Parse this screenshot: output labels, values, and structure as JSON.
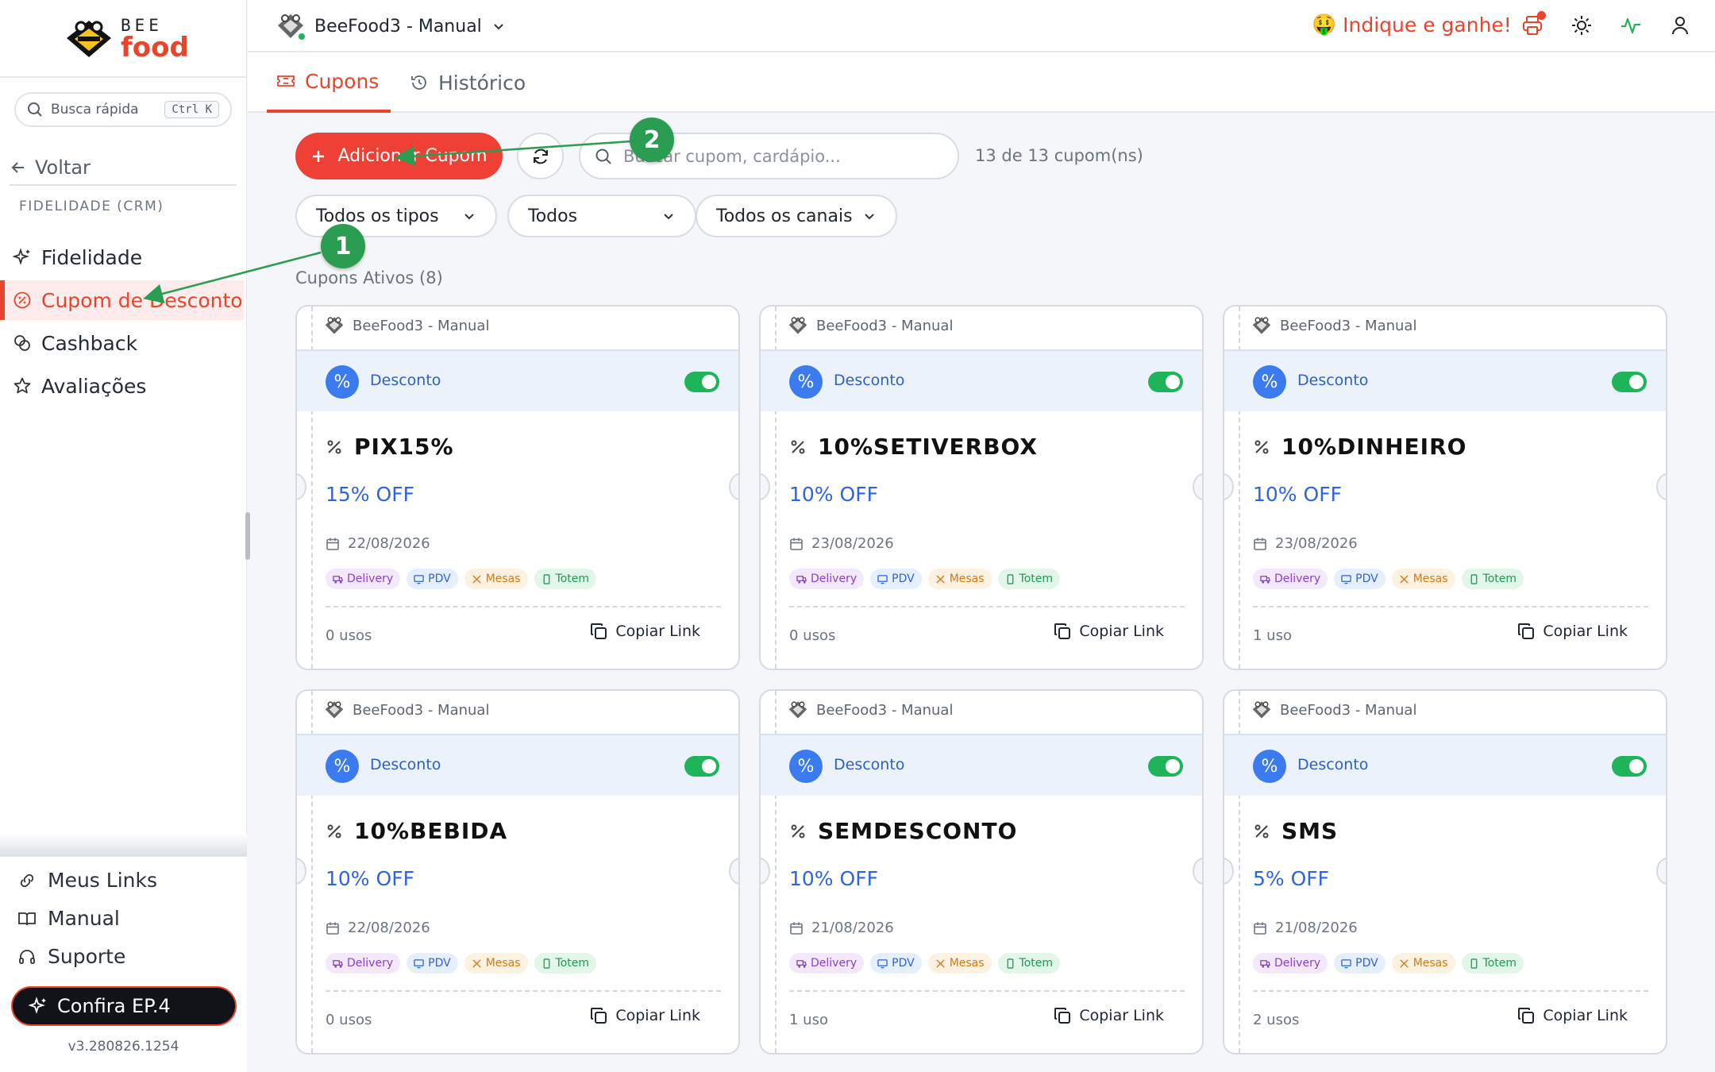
{
  "sidebar": {
    "logo_top": "BEE",
    "logo_bottom": "food",
    "quick_search": "Busca rápida",
    "quick_kbd": "Ctrl K",
    "back": "Voltar",
    "section": "FIDELIDADE (CRM)",
    "items": [
      {
        "label": "Fidelidade",
        "icon": "sparkles-icon"
      },
      {
        "label": "Cupom de Desconto",
        "icon": "coupon-icon",
        "active": true
      },
      {
        "label": "Cashback",
        "icon": "coins-icon"
      },
      {
        "label": "Avaliações",
        "icon": "star-icon"
      }
    ],
    "bottom": [
      {
        "label": "Meus Links",
        "icon": "link-icon"
      },
      {
        "label": "Manual",
        "icon": "book-icon"
      },
      {
        "label": "Suporte",
        "icon": "headset-icon"
      }
    ],
    "ep_button": "Confira EP.4",
    "version": "v3.280826.1254"
  },
  "topbar": {
    "store": "BeeFood3 - Manual",
    "indique": "Indique e ganhe!",
    "indique_emoji": "🤑"
  },
  "tabs": [
    {
      "label": "Cupons",
      "active": true
    },
    {
      "label": "Histórico",
      "active": false
    }
  ],
  "toolbar": {
    "add_label": "Adicionar Cupom",
    "search_placeholder": "Buscar cupom, cardápio...",
    "count": "13 de 13 cupom(ns)",
    "filters": [
      "Todos os tipos",
      "Todos",
      "Todos os canais"
    ]
  },
  "active_label": "Cupons Ativos (8)",
  "channels": [
    "Delivery",
    "PDV",
    "Mesas",
    "Totem"
  ],
  "copy_label": "Copiar Link",
  "coupons": [
    {
      "store": "BeeFood3 - Manual",
      "type": "Desconto",
      "code": "PIX15%",
      "off": "15% OFF",
      "date": "22/08/2026",
      "uses": "0 usos",
      "enabled": true
    },
    {
      "store": "BeeFood3 - Manual",
      "type": "Desconto",
      "code": "10%SETIVERBOX",
      "off": "10% OFF",
      "date": "23/08/2026",
      "uses": "0 usos",
      "enabled": true
    },
    {
      "store": "BeeFood3 - Manual",
      "type": "Desconto",
      "code": "10%DINHEIRO",
      "off": "10% OFF",
      "date": "23/08/2026",
      "uses": "1 uso",
      "enabled": true
    },
    {
      "store": "BeeFood3 - Manual",
      "type": "Desconto",
      "code": "10%BEBIDA",
      "off": "10% OFF",
      "date": "22/08/2026",
      "uses": "0 usos",
      "enabled": true
    },
    {
      "store": "BeeFood3 - Manual",
      "type": "Desconto",
      "code": "SEMDESCONTO",
      "off": "10% OFF",
      "date": "21/08/2026",
      "uses": "1 uso",
      "enabled": true
    },
    {
      "store": "BeeFood3 - Manual",
      "type": "Desconto",
      "code": "SMS",
      "off": "5% OFF",
      "date": "21/08/2026",
      "uses": "2 usos",
      "enabled": true
    }
  ],
  "annotations": [
    "1",
    "2"
  ],
  "colors": {
    "accent": "#e8452c",
    "annotation": "#2a9d52",
    "toggle_on": "#1fb35a",
    "discount_blue": "#2d64e6"
  }
}
